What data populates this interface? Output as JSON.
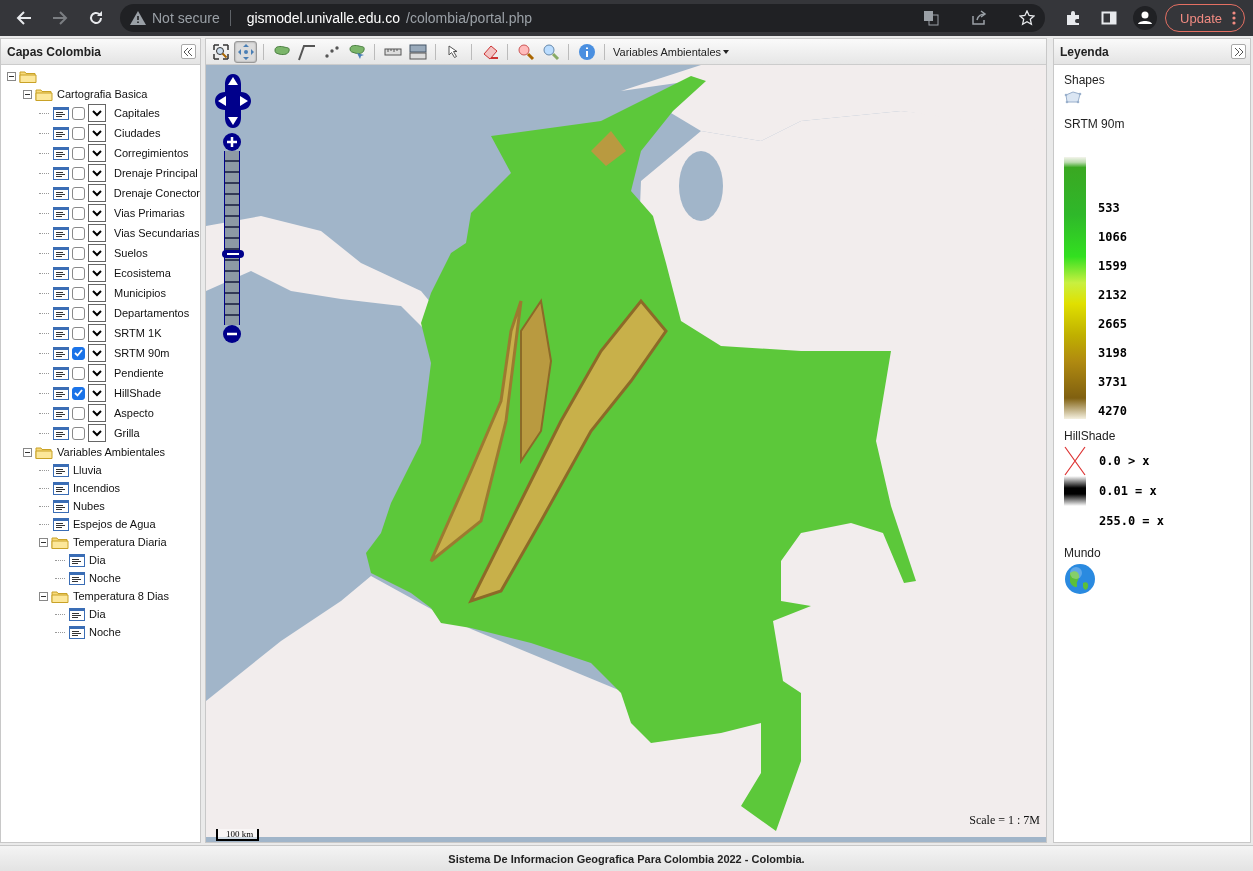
{
  "browser": {
    "forward_disabled": true,
    "security_label": "Not secure",
    "url_host": "gismodel.univalle.edu.co",
    "url_path": "/colombia/portal.php",
    "update_button": "Update"
  },
  "left_panel": {
    "title": "Capas Colombia",
    "tree": [
      {
        "kind": "folder",
        "expanded": true,
        "children": [
          {
            "kind": "folder",
            "label": "Cartografia Basica",
            "expanded": true,
            "children": [
              {
                "kind": "toggle-layer",
                "label": "Capitales",
                "checked": false
              },
              {
                "kind": "toggle-layer",
                "label": "Ciudades",
                "checked": false
              },
              {
                "kind": "toggle-layer",
                "label": "Corregimientos",
                "checked": false
              },
              {
                "kind": "toggle-layer",
                "label": "Drenaje Principal",
                "checked": false
              },
              {
                "kind": "toggle-layer",
                "label": "Drenaje Conector",
                "checked": false
              },
              {
                "kind": "toggle-layer",
                "label": "Vias Primarias",
                "checked": false
              },
              {
                "kind": "toggle-layer",
                "label": "Vias Secundarias",
                "checked": false
              },
              {
                "kind": "toggle-layer",
                "label": "Suelos",
                "checked": false
              },
              {
                "kind": "toggle-layer",
                "label": "Ecosistema",
                "checked": false
              },
              {
                "kind": "toggle-layer",
                "label": "Municipios",
                "checked": false
              },
              {
                "kind": "toggle-layer",
                "label": "Departamentos",
                "checked": false
              },
              {
                "kind": "toggle-layer",
                "label": "SRTM 1K",
                "checked": false
              },
              {
                "kind": "toggle-layer",
                "label": "SRTM 90m",
                "checked": true
              },
              {
                "kind": "toggle-layer",
                "label": "Pendiente",
                "checked": false
              },
              {
                "kind": "toggle-layer",
                "label": "HillShade",
                "checked": true
              },
              {
                "kind": "toggle-layer",
                "label": "Aspecto",
                "checked": false
              },
              {
                "kind": "toggle-layer",
                "label": "Grilla",
                "checked": false
              }
            ]
          },
          {
            "kind": "folder",
            "label": "Variables Ambientales",
            "expanded": true,
            "children": [
              {
                "kind": "layer",
                "label": "Lluvia"
              },
              {
                "kind": "layer",
                "label": "Incendios"
              },
              {
                "kind": "layer",
                "label": "Nubes"
              },
              {
                "kind": "layer",
                "label": "Espejos de Agua"
              },
              {
                "kind": "folder",
                "label": "Temperatura Diaria",
                "expanded": true,
                "children": [
                  {
                    "kind": "layer",
                    "label": "Dia"
                  },
                  {
                    "kind": "layer",
                    "label": "Noche"
                  }
                ]
              },
              {
                "kind": "folder",
                "label": "Temperatura 8 Dias",
                "expanded": true,
                "children": [
                  {
                    "kind": "layer",
                    "label": "Dia"
                  },
                  {
                    "kind": "layer",
                    "label": "Noche"
                  }
                ]
              }
            ]
          }
        ]
      }
    ]
  },
  "toolbar": {
    "groups": [
      [
        {
          "selected": false
        },
        {
          "selected": true
        }
      ],
      [
        {
          "selected": false
        },
        {
          "selected": false
        },
        {
          "selected": false
        },
        {
          "selected": false
        }
      ],
      [
        {
          "selected": false
        },
        {
          "selected": false
        }
      ],
      [
        {
          "selected": false
        }
      ],
      [
        {
          "selected": false
        }
      ],
      [
        {
          "selected": false
        },
        {
          "selected": false
        }
      ],
      [
        {
          "selected": false
        }
      ]
    ],
    "dropdown": "Variables Ambientales"
  },
  "map": {
    "zoom_slider": {
      "level": 0.41
    },
    "scale_bar": "100 km",
    "scale_text": "Scale = 1 : 7M"
  },
  "legend": {
    "title": "Leyenda",
    "sections": [
      {
        "kind": "shapes",
        "title": "Shapes"
      },
      {
        "kind": "ramp",
        "title": "SRTM 90m",
        "labels": [
          "533",
          "1066",
          "1599",
          "2132",
          "2665",
          "3198",
          "3731",
          "4270"
        ]
      },
      {
        "kind": "classes",
        "title": "HillShade",
        "labels": [
          "0.0 > x",
          "0.01 = x",
          "255.0 = x"
        ]
      },
      {
        "kind": "globe",
        "title": "Mundo"
      }
    ]
  },
  "footer": "Sistema De Informacion Geografica Para Colombia 2022 - Colombia."
}
